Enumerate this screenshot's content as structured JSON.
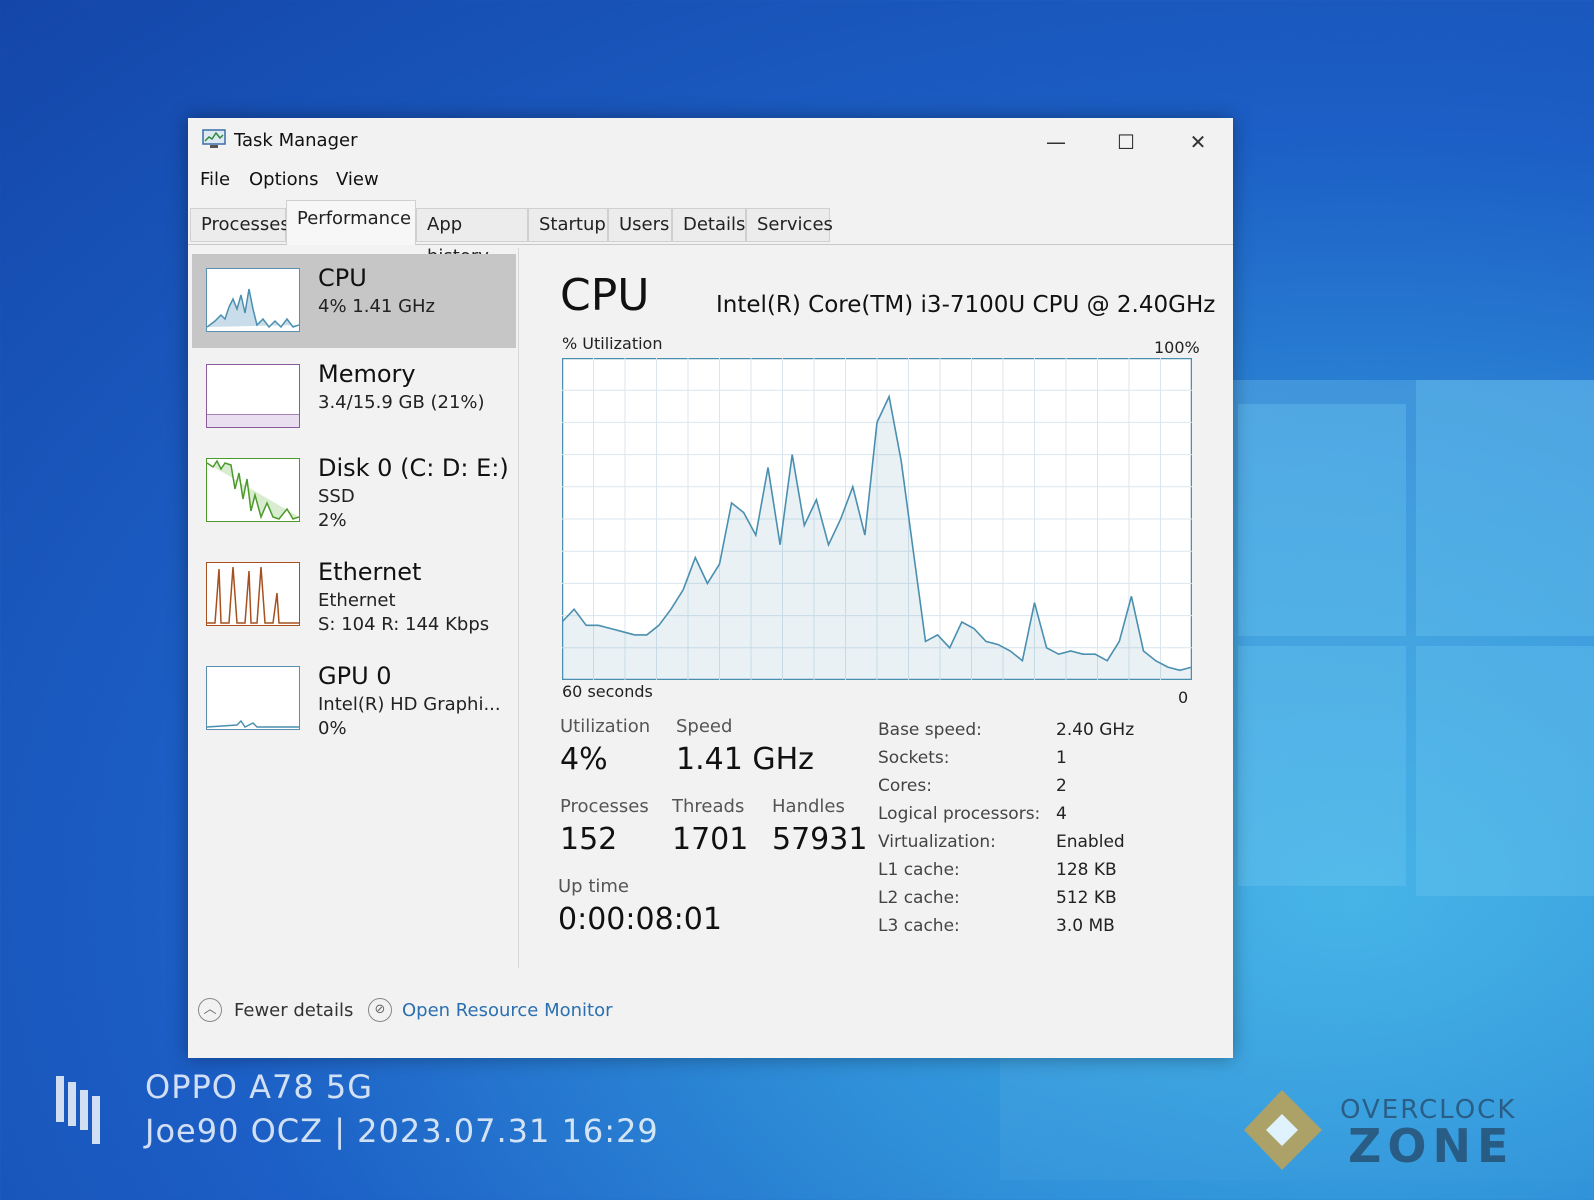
{
  "window": {
    "title": "Task Manager",
    "minimize": "—",
    "maximize": "☐",
    "close": "✕"
  },
  "menu": [
    "File",
    "Options",
    "View"
  ],
  "tabs": [
    "Processes",
    "Performance",
    "App history",
    "Startup",
    "Users",
    "Details",
    "Services"
  ],
  "sidebar": {
    "cpu": {
      "title": "CPU",
      "sub1": "4% 1.41 GHz"
    },
    "memory": {
      "title": "Memory",
      "sub1": "3.4/15.9 GB (21%)"
    },
    "disk": {
      "title": "Disk 0 (C: D: E:)",
      "sub1": "SSD",
      "sub2": "2%"
    },
    "ethernet": {
      "title": "Ethernet",
      "sub1": "Ethernet",
      "sub2": "S: 104 R: 144 Kbps"
    },
    "gpu": {
      "title": "GPU 0",
      "sub1": "Intel(R) HD Graphi...",
      "sub2": "0%"
    }
  },
  "main": {
    "title": "CPU",
    "model": "Intel(R) Core(TM) i3-7100U CPU @ 2.40GHz",
    "util_label": "% Utilization",
    "max_label": "100%",
    "time_label": "60 seconds",
    "min_label": "0",
    "stats": {
      "utilization_label": "Utilization",
      "utilization": "4%",
      "speed_label": "Speed",
      "speed": "1.41 GHz",
      "processes_label": "Processes",
      "processes": "152",
      "threads_label": "Threads",
      "threads": "1701",
      "handles_label": "Handles",
      "handles": "57931",
      "uptime_label": "Up time",
      "uptime": "0:00:08:01"
    },
    "specs": [
      {
        "label": "Base speed:",
        "value": "2.40 GHz"
      },
      {
        "label": "Sockets:",
        "value": "1"
      },
      {
        "label": "Cores:",
        "value": "2"
      },
      {
        "label": "Logical processors:",
        "value": "4"
      },
      {
        "label": "Virtualization:",
        "value": "Enabled"
      },
      {
        "label": "L1 cache:",
        "value": "128 KB"
      },
      {
        "label": "L2 cache:",
        "value": "512 KB"
      },
      {
        "label": "L3 cache:",
        "value": "3.0 MB"
      }
    ]
  },
  "footer": {
    "fewer_details": "Fewer details",
    "resource_monitor": "Open Resource Monitor"
  },
  "watermark": {
    "device": "OPPO A78 5G",
    "info": "Joe90 OCZ | 2023.07.31 16:29",
    "brand_top": "OVERCLOCK",
    "brand_bottom": "ZONE"
  },
  "colors": {
    "cpu_line": "#4a8fb0",
    "disk_line": "#4c9a2a",
    "ethernet_line": "#a7501e",
    "link": "#2b6fb0"
  },
  "chart_data": {
    "type": "area",
    "ylabel": "% Utilization",
    "ylim": [
      0,
      100
    ],
    "xlim": [
      0,
      60
    ],
    "x": [
      0,
      1,
      2,
      3,
      4,
      5,
      6,
      7,
      8,
      9,
      10,
      11,
      12,
      13,
      14,
      15,
      16,
      17,
      18,
      19,
      20,
      21,
      22,
      23,
      24,
      25,
      26,
      27,
      28,
      29,
      30,
      31,
      32,
      33,
      34,
      35,
      36,
      37,
      38,
      39,
      40,
      41,
      42,
      43,
      44,
      45,
      46,
      47,
      48,
      49,
      50,
      51,
      52,
      53,
      54,
      55,
      56,
      57,
      58,
      59,
      60
    ],
    "series": [
      {
        "values": [
          18,
          22,
          17,
          17,
          16,
          15,
          14,
          14,
          17,
          22,
          28,
          38,
          30,
          36,
          55,
          52,
          45,
          66,
          42,
          70,
          48,
          56,
          42,
          50,
          60,
          45,
          80,
          88,
          68,
          40,
          12,
          14,
          10,
          18,
          16,
          12,
          11,
          9,
          6,
          24,
          10,
          8,
          9,
          8,
          8,
          6,
          12,
          26,
          9,
          6,
          4,
          3,
          4
        ]
      }
    ]
  }
}
